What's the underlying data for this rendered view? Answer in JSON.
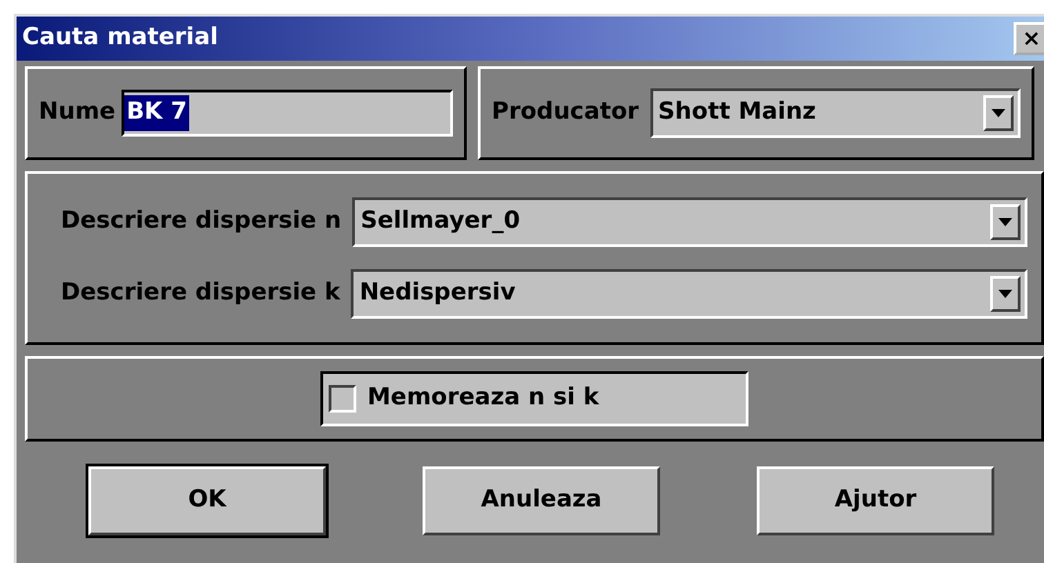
{
  "window": {
    "title": "Cauta material",
    "close": "×"
  },
  "name_field": {
    "label": "Nume",
    "value": "BK 7",
    "selected": true
  },
  "producer": {
    "label": "Producator",
    "value": "Shott Mainz"
  },
  "dispersion": [
    {
      "label": "Descriere dispersie n",
      "value": "Sellmayer_0"
    },
    {
      "label": "Descriere dispersie k",
      "value": "Nedispersiv"
    }
  ],
  "memorize": {
    "label": "Memoreaza n si k",
    "checked": false
  },
  "buttons": [
    {
      "label": "OK",
      "default": true
    },
    {
      "label": "Anuleaza",
      "default": false
    },
    {
      "label": "Ajutor",
      "default": false
    }
  ]
}
